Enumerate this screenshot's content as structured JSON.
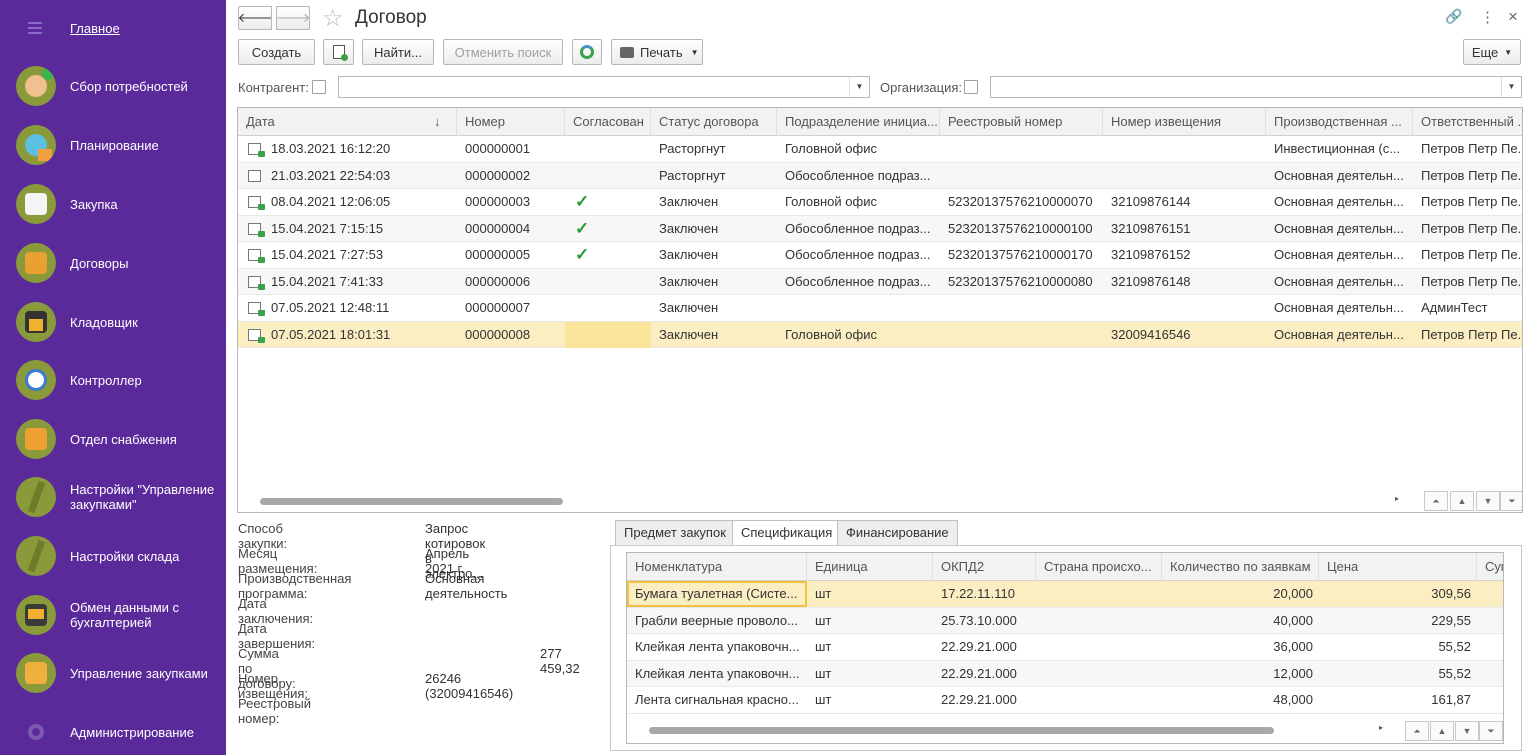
{
  "sidebar": {
    "items": [
      {
        "label": "Главное"
      },
      {
        "label": "Сбор потребностей"
      },
      {
        "label": "Планирование"
      },
      {
        "label": "Закупка"
      },
      {
        "label": "Договоры"
      },
      {
        "label": "Кладовщик"
      },
      {
        "label": "Контроллер"
      },
      {
        "label": "Отдел снабжения"
      },
      {
        "label": "Настройки \"Управление закупками\""
      },
      {
        "label": "Настройки склада"
      },
      {
        "label": "Обмен данными с бухгалтерией"
      },
      {
        "label": "Управление закупками"
      },
      {
        "label": "Администрирование"
      }
    ]
  },
  "header": {
    "title": "Договор",
    "back": "🡐",
    "forward": "🡒",
    "star": "☆",
    "link": "🔗",
    "more": "⋮",
    "close": "×"
  },
  "toolbar": {
    "create": "Создать",
    "find": "Найти...",
    "cancel_search": "Отменить поиск",
    "print": "Печать",
    "more": "Еще"
  },
  "filters": {
    "counterparty_label": "Контрагент:",
    "organization_label": "Организация:"
  },
  "table": {
    "columns": [
      "Дата",
      "Номер",
      "Согласован",
      "Статус договора",
      "Подразделение инициа...",
      "Реестровый номер",
      "Номер извещения",
      "Производственная ...",
      "Ответственный ..."
    ],
    "sort_arrow": "↓",
    "rows": [
      {
        "date": "18.03.2021 16:12:20",
        "number": "000000001",
        "agreed": "",
        "status": "Расторгнут",
        "division": "Головной офис",
        "reg": "",
        "notice": "",
        "program": "Инвестиционная (с...",
        "resp": "Петров Петр Пе..."
      },
      {
        "date": "21.03.2021 22:54:03",
        "number": "000000002",
        "agreed": "",
        "status": "Расторгнут",
        "division": "Обособленное подраз...",
        "reg": "",
        "notice": "",
        "program": "Основная деятельн...",
        "resp": "Петров Петр Пе..."
      },
      {
        "date": "08.04.2021 12:06:05",
        "number": "000000003",
        "agreed": "✓",
        "status": "Заключен",
        "division": "Головной офис",
        "reg": "52320137576210000070",
        "notice": "32109876144",
        "program": "Основная деятельн...",
        "resp": "Петров Петр Пе..."
      },
      {
        "date": "15.04.2021 7:15:15",
        "number": "000000004",
        "agreed": "✓",
        "status": "Заключен",
        "division": "Обособленное подраз...",
        "reg": "52320137576210000100",
        "notice": "32109876151",
        "program": "Основная деятельн...",
        "resp": "Петров Петр Пе..."
      },
      {
        "date": "15.04.2021 7:27:53",
        "number": "000000005",
        "agreed": "✓",
        "status": "Заключен",
        "division": "Обособленное подраз...",
        "reg": "52320137576210000170",
        "notice": "32109876152",
        "program": "Основная деятельн...",
        "resp": "Петров Петр Пе..."
      },
      {
        "date": "15.04.2021 7:41:33",
        "number": "000000006",
        "agreed": "",
        "status": "Заключен",
        "division": "Обособленное подраз...",
        "reg": "52320137576210000080",
        "notice": "32109876148",
        "program": "Основная деятельн...",
        "resp": "Петров Петр Пе..."
      },
      {
        "date": "07.05.2021 12:48:11",
        "number": "000000007",
        "agreed": "",
        "status": "Заключен",
        "division": "",
        "reg": "",
        "notice": "",
        "program": "Основная деятельн...",
        "resp": "АдминТест"
      },
      {
        "date": "07.05.2021 18:01:31",
        "number": "000000008",
        "agreed": "",
        "status": "Заключен",
        "division": "Головной офис",
        "reg": "",
        "notice": "32009416546",
        "program": "Основная деятельн...",
        "resp": "Петров Петр Пе..."
      }
    ]
  },
  "details": {
    "purchase_method_label": "Способ закупки:",
    "purchase_method": "Запрос котировок в электро...",
    "month_label": "Месяц размещения:",
    "month": "Апрель 2021 г.",
    "program_label": "Производственная программа:",
    "program": "Основная деятельность",
    "conclusion_label": "Дата заключения:",
    "completion_label": "Дата завершения:",
    "sum_label": "Сумма по договору:",
    "sum": "277 459,32",
    "notice_label": "Номер извещения:",
    "notice": "26246 (32009416546)",
    "reg_label": "Реестровый номер:"
  },
  "tabs": [
    "Предмет закупок",
    "Спецификация",
    "Финансирование"
  ],
  "spec": {
    "columns": [
      "Номенклатура",
      "Единица",
      "ОКПД2",
      "Страна происхо...",
      "Количество по заявкам",
      "Цена",
      "Сум"
    ],
    "rows": [
      {
        "name": "Бумага туалетная (Систе...",
        "unit": "шт",
        "okpd": "17.22.11.110",
        "country": "",
        "qty": "20,000",
        "price": "309,56"
      },
      {
        "name": "Грабли веерные проволо...",
        "unit": "шт",
        "okpd": "25.73.10.000",
        "country": "",
        "qty": "40,000",
        "price": "229,55"
      },
      {
        "name": "Клейкая лента упаковочн...",
        "unit": "шт",
        "okpd": "22.29.21.000",
        "country": "",
        "qty": "36,000",
        "price": "55,52"
      },
      {
        "name": "Клейкая лента упаковочн...",
        "unit": "шт",
        "okpd": "22.29.21.000",
        "country": "",
        "qty": "12,000",
        "price": "55,52"
      },
      {
        "name": "Лента сигнальная красно...",
        "unit": "шт",
        "okpd": "22.29.21.000",
        "country": "",
        "qty": "48,000",
        "price": "161,87"
      }
    ]
  }
}
